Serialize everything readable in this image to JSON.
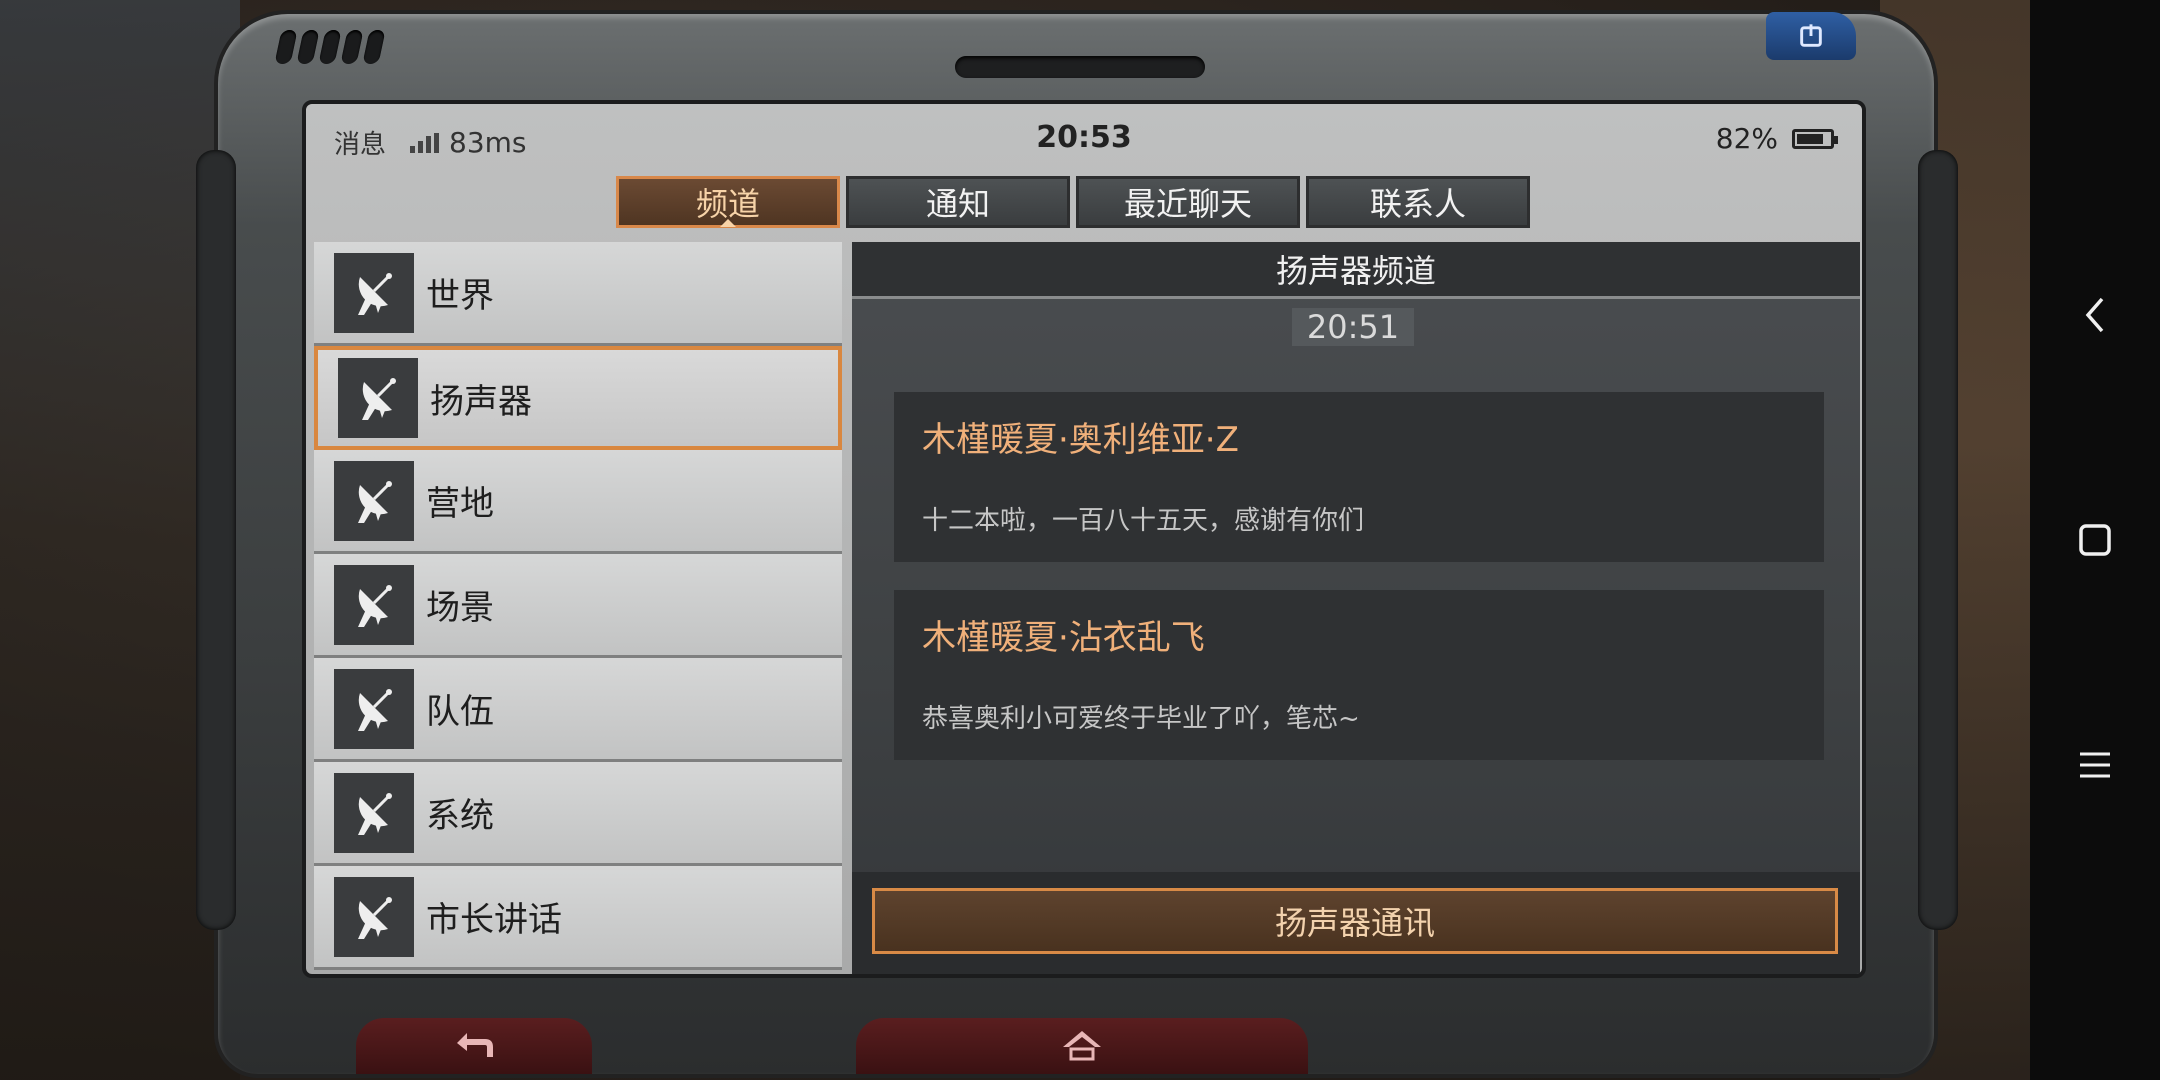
{
  "statusbar": {
    "app_label": "消息",
    "ping": "83ms",
    "time": "20:53",
    "battery": "82%",
    "battery_level": 0.82
  },
  "tabs": [
    {
      "label": "频道",
      "active": true
    },
    {
      "label": "通知",
      "active": false
    },
    {
      "label": "最近聊天",
      "active": false
    },
    {
      "label": "联系人",
      "active": false
    }
  ],
  "channels": [
    {
      "label": "世界",
      "icon": "satellite-dish-icon"
    },
    {
      "label": "扬声器",
      "icon": "satellite-dish-icon",
      "selected": true
    },
    {
      "label": "营地",
      "icon": "satellite-dish-icon"
    },
    {
      "label": "场景",
      "icon": "satellite-dish-icon"
    },
    {
      "label": "队伍",
      "icon": "satellite-dish-icon"
    },
    {
      "label": "系统",
      "icon": "satellite-dish-icon"
    },
    {
      "label": "市长讲话",
      "icon": "satellite-dish-icon"
    }
  ],
  "panel": {
    "title": "扬声器频道",
    "timestamp": "20:51",
    "messages": [
      {
        "sender": "木槿暖夏·奥利维亚·Z",
        "text": "十二本啦，一百八十五天，感谢有你们"
      },
      {
        "sender": "木槿暖夏·沾衣乱飞",
        "text": "恭喜奥利小可爱终于毕业了吖，笔芯~"
      }
    ],
    "action_label": "扬声器通讯"
  },
  "colors": {
    "accent": "#d8884a",
    "sender_text": "#f0b07a"
  }
}
